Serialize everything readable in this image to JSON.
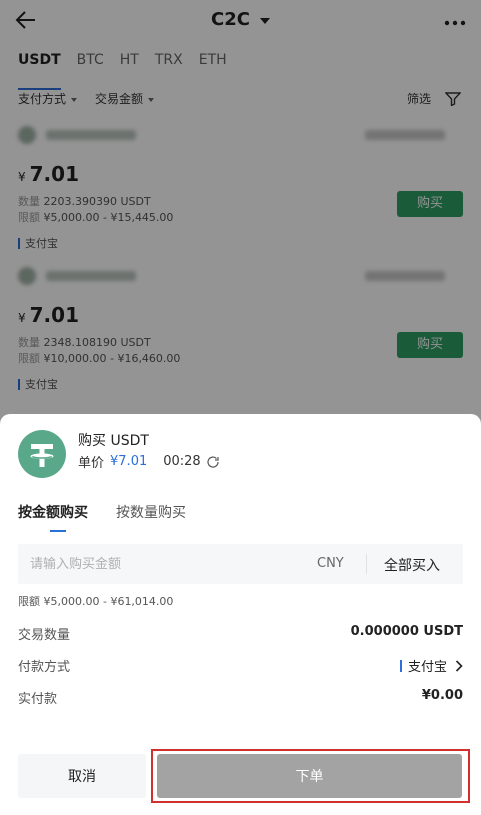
{
  "header": {
    "title": "C2C"
  },
  "coin_tabs": [
    "USDT",
    "BTC",
    "HT",
    "TRX",
    "ETH"
  ],
  "filters": {
    "payment_method": "支付方式",
    "amount": "交易金额",
    "filter_label": "筛选"
  },
  "merchants": [
    {
      "currency_symbol": "¥",
      "price": "7.01",
      "quantity_label": "数量",
      "quantity": "2203.390390 USDT",
      "limit_label": "限额",
      "limit": "¥5,000.00 - ¥15,445.00",
      "buy_label": "购买",
      "pay_method": "支付宝"
    },
    {
      "currency_symbol": "¥",
      "price": "7.01",
      "quantity_label": "数量",
      "quantity": "2348.108190 USDT",
      "limit_label": "限额",
      "limit": "¥10,000.00 - ¥16,460.00",
      "buy_label": "购买",
      "pay_method": "支付宝"
    }
  ],
  "sheet": {
    "title": "购买 USDT",
    "unit_price_label": "单价",
    "unit_price": "¥7.01",
    "countdown": "00:28",
    "tabs": [
      "按金额购买",
      "按数量购买"
    ],
    "input_placeholder": "请输入购买金额",
    "input_value": "",
    "currency": "CNY",
    "buy_all_label": "全部买入",
    "limit_text": "限额 ¥5,000.00 - ¥61,014.00",
    "rows": {
      "quantity_label": "交易数量",
      "quantity_value": "0.000000 USDT",
      "pay_label": "付款方式",
      "pay_value": "支付宝",
      "actual_label": "实付款",
      "actual_value": "¥0.00"
    },
    "cancel_label": "取消",
    "order_label": "下单"
  },
  "colors": {
    "accent": "#2a6fdb",
    "buy_green": "#2e9d64",
    "usdt_logo": "#5aa88a",
    "disabled_button": "#a3a3a3",
    "highlight_border": "#d2302f"
  }
}
